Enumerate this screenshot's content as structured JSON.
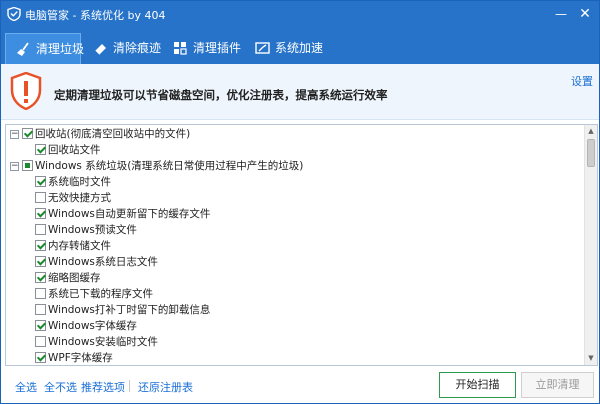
{
  "window": {
    "title": "电脑管家 - 系统优化 by 404",
    "minimize_glyph": "—",
    "close_glyph": "✕",
    "accent_color": "#2673c9",
    "active_tab_color": "#3d8de0"
  },
  "tabs": [
    {
      "label": "清理垃圾",
      "icon": "broom-icon",
      "active": true
    },
    {
      "label": "清除痕迹",
      "icon": "eraser-icon",
      "active": false
    },
    {
      "label": "清理插件",
      "icon": "plugin-icon",
      "active": false
    },
    {
      "label": "系统加速",
      "icon": "speedup-icon",
      "active": false
    }
  ],
  "banner": {
    "icon": "warning-shield-icon",
    "message": "定期清理垃圾可以节省磁盘空间，优化注册表，提高系统运行效率",
    "settings_label": "设置"
  },
  "tree": {
    "groups": [
      {
        "label": "回收站(彻底清空回收站中的文件)",
        "expand_glyph": "−",
        "state": "checked",
        "items": [
          {
            "label": "回收站文件",
            "checked": true
          }
        ]
      },
      {
        "label": "Windows 系统垃圾(清理系统日常使用过程中产生的垃圾)",
        "expand_glyph": "−",
        "state": "partial",
        "items": [
          {
            "label": "系统临时文件",
            "checked": true
          },
          {
            "label": "无效快捷方式",
            "checked": false
          },
          {
            "label": "Windows自动更新留下的缓存文件",
            "checked": true
          },
          {
            "label": "Windows预读文件",
            "checked": false
          },
          {
            "label": "内存转储文件",
            "checked": true
          },
          {
            "label": "Windows系统日志文件",
            "checked": true
          },
          {
            "label": "缩略图缓存",
            "checked": true
          },
          {
            "label": "系统已下载的程序文件",
            "checked": false
          },
          {
            "label": "Windows打补丁时留下的卸载信息",
            "checked": false
          },
          {
            "label": "Windows字体缓存",
            "checked": true
          },
          {
            "label": "Windows安装临时文件",
            "checked": false
          },
          {
            "label": "WPF字体缓存",
            "checked": true
          }
        ]
      }
    ],
    "scroll_position": 0.02
  },
  "footer": {
    "select_all": "全选",
    "select_none": "全不选",
    "recommended": "推荐选项",
    "restore_registry": "还原注册表",
    "scan_button": "开始扫描",
    "clean_button": "立即清理"
  }
}
